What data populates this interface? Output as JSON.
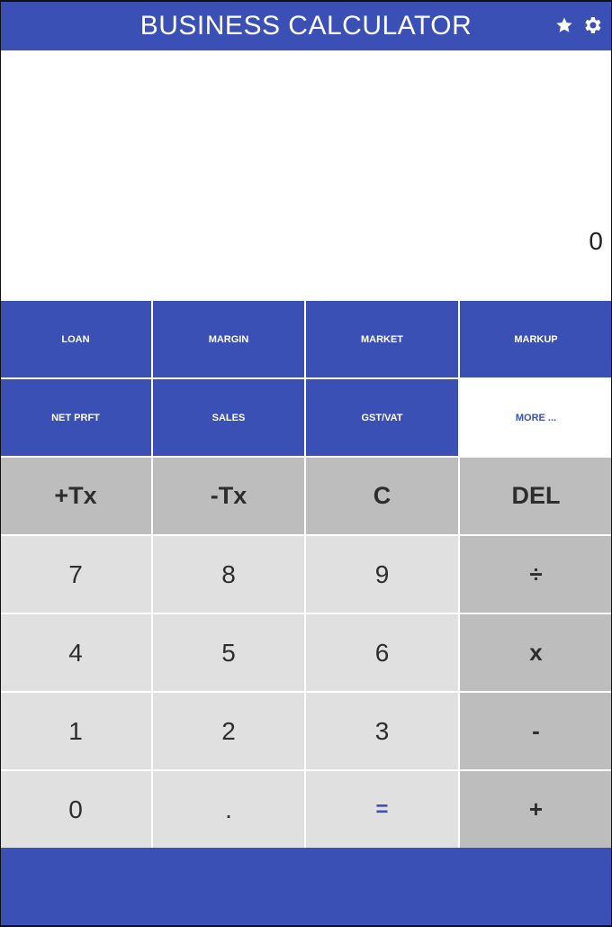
{
  "appbar": {
    "title": "BUSINESS CALCULATOR",
    "icons": [
      "star-icon",
      "gear-icon"
    ]
  },
  "display": {
    "value": "0"
  },
  "functions": {
    "row1": [
      "LOAN",
      "MARGIN",
      "MARKET",
      "MARKUP"
    ],
    "row2": [
      "NET PRFT",
      "SALES",
      "GST/VAT",
      "MORE ..."
    ]
  },
  "keypad": {
    "row_top": [
      "+Tx",
      "-Tx",
      "C",
      "DEL"
    ],
    "row_7": [
      "7",
      "8",
      "9",
      "÷"
    ],
    "row_4": [
      "4",
      "5",
      "6",
      "x"
    ],
    "row_1": [
      "1",
      "2",
      "3",
      "-"
    ],
    "row_0": [
      "0",
      ".",
      "=",
      "+"
    ]
  },
  "colors": {
    "primary": "#3a50b4",
    "key_light": "#e0e0e0",
    "key_dark": "#bdbdbd"
  }
}
